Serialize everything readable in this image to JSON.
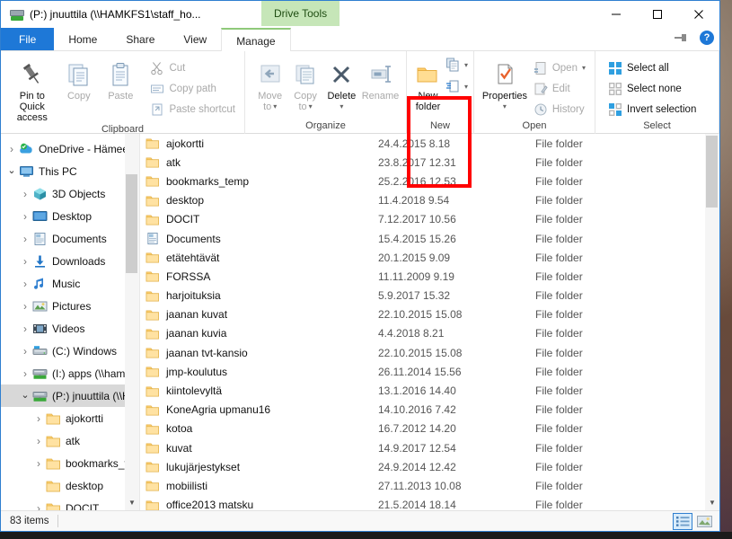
{
  "window": {
    "title": "(P:) jnuuttila (\\\\HAMKFS1\\staff_ho...",
    "title_icon": "network-drive-icon",
    "contextual_tab": "Drive Tools",
    "minimize_label": "Minimize",
    "maximize_label": "Maximize",
    "close_label": "Close"
  },
  "tabs": [
    {
      "label": "File",
      "kind": "file"
    },
    {
      "label": "Home",
      "kind": "normal"
    },
    {
      "label": "Share",
      "kind": "normal"
    },
    {
      "label": "View",
      "kind": "normal"
    },
    {
      "label": "Manage",
      "kind": "contextual-active"
    }
  ],
  "ribbon": {
    "collapse_icon": "pin-ribbon-icon",
    "help_icon": "help-icon",
    "groups": [
      {
        "name": "Clipboard",
        "label": "Clipboard",
        "big_buttons": [
          {
            "label": "Pin to Quick\naccess",
            "line1": "Pin to Quick",
            "line2": "access",
            "icon": "pin-icon",
            "enabled": true
          },
          {
            "label": "Copy",
            "line1": "Copy",
            "line2": "",
            "icon": "copy-icon",
            "enabled": false
          },
          {
            "label": "Paste",
            "line1": "Paste",
            "line2": "",
            "icon": "paste-icon",
            "enabled": false
          }
        ],
        "small_buttons": [
          {
            "label": "Cut",
            "icon": "scissors-icon",
            "enabled": false
          },
          {
            "label": "Copy path",
            "icon": "copy-path-icon",
            "enabled": false
          },
          {
            "label": "Paste shortcut",
            "icon": "paste-shortcut-icon",
            "enabled": false
          }
        ]
      },
      {
        "name": "Organize",
        "label": "Organize",
        "big_buttons": [
          {
            "line1": "Move",
            "line2": "to",
            "icon": "move-to-icon",
            "enabled": false,
            "dropdown": true
          },
          {
            "line1": "Copy",
            "line2": "to",
            "icon": "copy-to-icon",
            "enabled": false,
            "dropdown": true
          },
          {
            "line1": "Delete",
            "line2": "",
            "icon": "delete-icon",
            "enabled": true,
            "dropdown": true
          },
          {
            "line1": "Rename",
            "line2": "",
            "icon": "rename-icon",
            "enabled": false
          }
        ]
      },
      {
        "name": "New",
        "label": "New",
        "highlighted": true,
        "big_buttons": [
          {
            "line1": "New",
            "line2": "folder",
            "icon": "new-folder-icon",
            "enabled": true
          }
        ],
        "small_buttons": [
          {
            "label": "",
            "icon": "new-item-icon",
            "enabled": true,
            "dropdown": true
          },
          {
            "label": "",
            "icon": "easy-access-icon",
            "enabled": true,
            "dropdown": true
          }
        ]
      },
      {
        "name": "Open",
        "label": "Open",
        "big_buttons": [
          {
            "line1": "Properties",
            "line2": "",
            "icon": "properties-icon",
            "enabled": true,
            "dropdown": true
          }
        ],
        "small_buttons": [
          {
            "label": "Open",
            "icon": "open-icon",
            "enabled": false,
            "dropdown": true
          },
          {
            "label": "Edit",
            "icon": "edit-icon",
            "enabled": false
          },
          {
            "label": "History",
            "icon": "history-icon",
            "enabled": false
          }
        ]
      },
      {
        "name": "Select",
        "label": "Select",
        "small_buttons": [
          {
            "label": "Select all",
            "icon": "select-all-icon",
            "enabled": true
          },
          {
            "label": "Select none",
            "icon": "select-none-icon",
            "enabled": true
          },
          {
            "label": "Invert selection",
            "icon": "invert-selection-icon",
            "enabled": true
          }
        ]
      }
    ]
  },
  "navigation": {
    "items": [
      {
        "label": "OneDrive - Hämee",
        "icon": "onedrive-icon",
        "indent": 0,
        "expander": "collapsed",
        "selected": false
      },
      {
        "label": "This PC",
        "icon": "this-pc-icon",
        "indent": 0,
        "expander": "expanded",
        "selected": false
      },
      {
        "label": "3D Objects",
        "icon": "3d-objects-icon",
        "indent": 1,
        "expander": "collapsed",
        "selected": false
      },
      {
        "label": "Desktop",
        "icon": "desktop-icon",
        "indent": 1,
        "expander": "collapsed",
        "selected": false
      },
      {
        "label": "Documents",
        "icon": "documents-icon",
        "indent": 1,
        "expander": "collapsed",
        "selected": false
      },
      {
        "label": "Downloads",
        "icon": "downloads-icon",
        "indent": 1,
        "expander": "collapsed",
        "selected": false
      },
      {
        "label": "Music",
        "icon": "music-icon",
        "indent": 1,
        "expander": "collapsed",
        "selected": false
      },
      {
        "label": "Pictures",
        "icon": "pictures-icon",
        "indent": 1,
        "expander": "collapsed",
        "selected": false
      },
      {
        "label": "Videos",
        "icon": "videos-icon",
        "indent": 1,
        "expander": "collapsed",
        "selected": false
      },
      {
        "label": "(C:) Windows",
        "icon": "local-disk-icon",
        "indent": 1,
        "expander": "collapsed",
        "selected": false
      },
      {
        "label": "(I:) apps (\\\\hamk",
        "icon": "network-drive-icon",
        "indent": 1,
        "expander": "collapsed",
        "selected": false
      },
      {
        "label": "(P:) jnuuttila (\\\\H",
        "icon": "network-drive-icon",
        "indent": 1,
        "expander": "expanded",
        "selected": true
      },
      {
        "label": "ajokortti",
        "icon": "folder-icon",
        "indent": 2,
        "expander": "collapsed",
        "selected": false
      },
      {
        "label": "atk",
        "icon": "folder-icon",
        "indent": 2,
        "expander": "collapsed",
        "selected": false
      },
      {
        "label": "bookmarks_ter",
        "icon": "folder-icon",
        "indent": 2,
        "expander": "collapsed",
        "selected": false
      },
      {
        "label": "desktop",
        "icon": "folder-icon",
        "indent": 2,
        "expander": "none",
        "selected": false
      },
      {
        "label": "DOCIT",
        "icon": "folder-icon",
        "indent": 2,
        "expander": "collapsed",
        "selected": false
      }
    ],
    "scroll_down_arrow": "▼"
  },
  "filelist": {
    "columns": [
      "Name",
      "Date modified",
      "Type"
    ],
    "rows": [
      {
        "name": "ajokortti",
        "date": "24.4.2015 8.18",
        "type": "File folder",
        "icon": "folder-icon"
      },
      {
        "name": "atk",
        "date": "23.8.2017 12.31",
        "type": "File folder",
        "icon": "folder-icon"
      },
      {
        "name": "bookmarks_temp",
        "date": "25.2.2016 12.53",
        "type": "File folder",
        "icon": "folder-icon"
      },
      {
        "name": "desktop",
        "date": "11.4.2018 9.54",
        "type": "File folder",
        "icon": "folder-icon"
      },
      {
        "name": "DOCIT",
        "date": "7.12.2017 10.56",
        "type": "File folder",
        "icon": "folder-icon"
      },
      {
        "name": "Documents",
        "date": "15.4.2015 15.26",
        "type": "File folder",
        "icon": "documents-folder-icon"
      },
      {
        "name": "etätehtävät",
        "date": "20.1.2015 9.09",
        "type": "File folder",
        "icon": "folder-icon"
      },
      {
        "name": "FORSSA",
        "date": "11.11.2009 9.19",
        "type": "File folder",
        "icon": "folder-icon"
      },
      {
        "name": "harjoituksia",
        "date": "5.9.2017 15.32",
        "type": "File folder",
        "icon": "folder-icon"
      },
      {
        "name": "jaanan kuvat",
        "date": "22.10.2015 15.08",
        "type": "File folder",
        "icon": "folder-icon"
      },
      {
        "name": "jaanan kuvia",
        "date": "4.4.2018 8.21",
        "type": "File folder",
        "icon": "folder-icon"
      },
      {
        "name": "jaanan tvt-kansio",
        "date": "22.10.2015 15.08",
        "type": "File folder",
        "icon": "folder-icon"
      },
      {
        "name": "jmp-koulutus",
        "date": "26.11.2014 15.56",
        "type": "File folder",
        "icon": "folder-icon"
      },
      {
        "name": "kiintolevyltä",
        "date": "13.1.2016 14.40",
        "type": "File folder",
        "icon": "folder-icon"
      },
      {
        "name": "KoneAgria upmanu16",
        "date": "14.10.2016 7.42",
        "type": "File folder",
        "icon": "folder-icon"
      },
      {
        "name": "kotoa",
        "date": "16.7.2012 14.20",
        "type": "File folder",
        "icon": "folder-icon"
      },
      {
        "name": "kuvat",
        "date": "14.9.2017 12.54",
        "type": "File folder",
        "icon": "folder-icon"
      },
      {
        "name": "lukujärjestykset",
        "date": "24.9.2014 12.42",
        "type": "File folder",
        "icon": "folder-icon"
      },
      {
        "name": "mobiilisti",
        "date": "27.11.2013 10.08",
        "type": "File folder",
        "icon": "folder-icon"
      },
      {
        "name": "office2013 matsku",
        "date": "21.5.2014 18.14",
        "type": "File folder",
        "icon": "folder-icon"
      }
    ]
  },
  "statusbar": {
    "item_count": "83 items",
    "views": [
      {
        "name": "details-view",
        "active": true
      },
      {
        "name": "large-icons-view",
        "active": false
      }
    ]
  },
  "colors": {
    "accent": "#1e78d7",
    "contextual_tab": "#c6e6b8",
    "highlight_box": "#ff0000",
    "folder": "#ffd071",
    "selected_row": "#d8d8d8"
  }
}
